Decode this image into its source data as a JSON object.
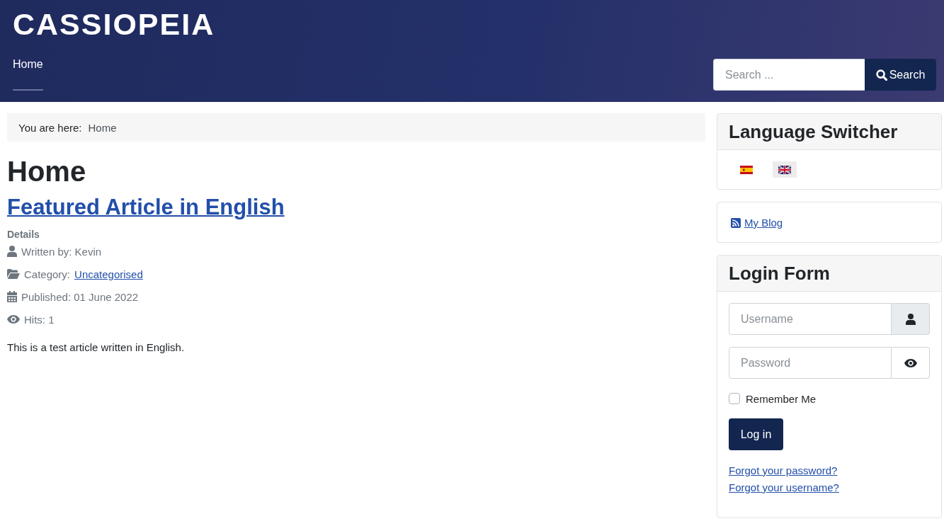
{
  "header": {
    "logo": "CASSIOPEIA",
    "nav": [
      {
        "label": "Home",
        "selected": true
      }
    ],
    "search": {
      "placeholder": "Search ...",
      "button": "Search"
    }
  },
  "breadcrumb": {
    "label": "You are here:",
    "items": [
      "Home"
    ]
  },
  "page_title": "Home",
  "article": {
    "title": "Featured Article in English",
    "details_heading": "Details",
    "meta": [
      {
        "kind": "author",
        "label": "Written by: Kevin"
      },
      {
        "kind": "category",
        "label": "Category:",
        "link": "Uncategorised"
      },
      {
        "kind": "published",
        "label": "Published: 01 June 2022"
      },
      {
        "kind": "hits",
        "label": "Hits: 1"
      }
    ],
    "body": "This is a test article written in English."
  },
  "sidebar": [
    {
      "kind": "language_switcher",
      "title": "Language Switcher",
      "languages": [
        {
          "kind": "spanish",
          "selected": false
        },
        {
          "kind": "english",
          "selected": true
        }
      ]
    },
    {
      "kind": "links",
      "items": [
        {
          "label": "My Blog"
        }
      ]
    },
    {
      "kind": "login",
      "title": "Login Form",
      "username": {
        "placeholder": "Username"
      },
      "password": {
        "placeholder": "Password"
      },
      "remember": {
        "label": "Remember Me",
        "checked": false
      },
      "submit": "Log in",
      "links": [
        "Forgot your password?",
        "Forgot your username?"
      ]
    }
  ]
}
